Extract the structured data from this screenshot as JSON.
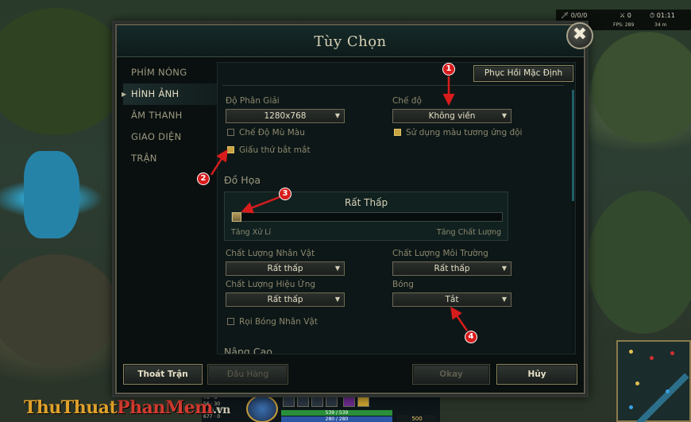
{
  "hud": {
    "kda": "0/0/0",
    "cs": "0",
    "timer": "01:11",
    "fps": "FPS: 289",
    "ping": "34 m",
    "hp": "539 / 539",
    "mp": "280 / 280",
    "gold": "500",
    "stats": [
      "76",
      "6",
      "56",
      "30",
      "0.86",
      "0",
      "677",
      "0"
    ]
  },
  "watermark": {
    "part1": "ThuThuat",
    "part2": "PhanMem",
    "part3": ".vn"
  },
  "dialog": {
    "title": "Tùy Chọn",
    "close_label": "✖",
    "sidebar": [
      {
        "label": "PHÍM NÓNG",
        "active": false
      },
      {
        "label": "HÌNH ẢNH",
        "active": true
      },
      {
        "label": "ÂM THANH",
        "active": false
      },
      {
        "label": "GIAO DIỆN",
        "active": false
      },
      {
        "label": "TRẬN",
        "active": false
      }
    ],
    "restore_defaults": "Phục Hồi Mặc Định",
    "resolution": {
      "label": "Độ Phân Giải",
      "value": "1280x768"
    },
    "mode": {
      "label": "Chế độ",
      "value": "Không viền"
    },
    "colorblind": {
      "label": "Chế Độ Mù Màu",
      "checked": false
    },
    "hide_eye_candy": {
      "label": "Giấu thứ bắt mắt",
      "checked": true
    },
    "relative_color": {
      "label": "Sử dụng màu tương ứng đội",
      "checked": true
    },
    "graphics": {
      "heading": "Đồ Họa",
      "quality_value": "Rất Thấp",
      "quality_level": 0,
      "low_label": "Tăng Xử Lí",
      "high_label": "Tăng Chất Lượng"
    },
    "character_quality": {
      "label": "Chất Lượng Nhân Vật",
      "value": "Rất thấp"
    },
    "environment_quality": {
      "label": "Chất Lượng Môi Trường",
      "value": "Rất thấp"
    },
    "effects_quality": {
      "label": "Chất Lượng Hiệu Ứng",
      "value": "Rất thấp"
    },
    "shadows": {
      "label": "Bóng",
      "value": "Tắt"
    },
    "char_shadows": {
      "label": "Rọi Bóng Nhân Vật",
      "checked": false
    },
    "advanced_heading": "Nâng Cao",
    "buttons": {
      "exit_game": "Thoát Trận",
      "surrender": "Đầu Hàng",
      "okay": "Okay",
      "cancel": "Hủy"
    }
  },
  "annotations": [
    "1",
    "2",
    "3",
    "4"
  ],
  "colors": {
    "annotation": "#d81c1c",
    "gold_accent": "#c9a442",
    "teal_scroll": "#1f5d66"
  }
}
